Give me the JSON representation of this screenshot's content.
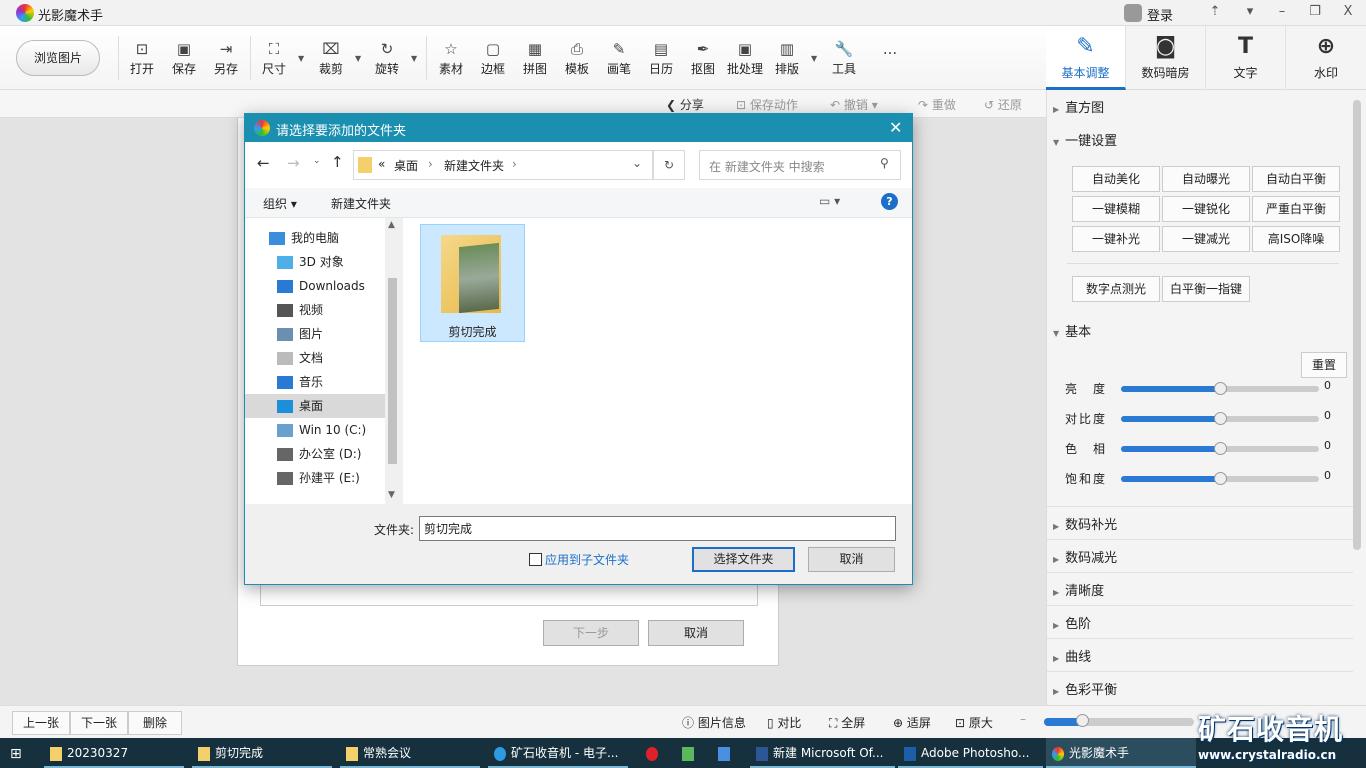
{
  "app": {
    "title": "光影魔术手",
    "login": "登录"
  },
  "toolbar": {
    "browse": "浏览图片",
    "tools": [
      "打开",
      "保存",
      "另存",
      "尺寸",
      "裁剪",
      "旋转",
      "素材",
      "边框",
      "拼图",
      "模板",
      "画笔",
      "日历",
      "抠图",
      "批处理",
      "排版",
      "工具"
    ],
    "more": "..."
  },
  "right_tabs": [
    {
      "label": "基本调整",
      "active": true
    },
    {
      "label": "数码暗房"
    },
    {
      "label": "文字"
    },
    {
      "label": "水印"
    }
  ],
  "subbar": {
    "share": "分享",
    "save_action": "保存动作",
    "undo": "撤销",
    "redo": "重做",
    "restore": "还原"
  },
  "wizard": {
    "next": "下一步",
    "cancel": "取消"
  },
  "panel": {
    "histogram": "直方图",
    "oneclick": "一键设置",
    "oneclick_buttons": [
      "自动美化",
      "自动曝光",
      "自动白平衡",
      "一键模糊",
      "一键锐化",
      "严重白平衡",
      "一键补光",
      "一键减光",
      "高ISO降噪"
    ],
    "extra_buttons": [
      "数字点测光",
      "白平衡一指键"
    ],
    "basic": "基本",
    "reset": "重置",
    "sliders": [
      {
        "label": "亮　度",
        "value": 0,
        "position": 0.5
      },
      {
        "label": "对比度",
        "value": 0,
        "position": 0.5
      },
      {
        "label": "色　相",
        "value": 0,
        "position": 0.5
      },
      {
        "label": "饱和度",
        "value": 0,
        "position": 0.5
      }
    ],
    "sections": [
      "数码补光",
      "数码减光",
      "清晰度",
      "色阶",
      "曲线",
      "色彩平衡"
    ]
  },
  "bottom": {
    "prev": "上一张",
    "next": "下一张",
    "delete": "删除",
    "info": "图片信息",
    "compare": "对比",
    "fullscreen": "全屏",
    "fit": "适屏",
    "original": "原大",
    "zoom": 0.25
  },
  "dialog": {
    "title": "请选择要添加的文件夹",
    "breadcrumb": [
      "«",
      "桌面",
      "新建文件夹"
    ],
    "search_placeholder": "在 新建文件夹 中搜索",
    "organize": "组织",
    "new_folder": "新建文件夹",
    "tree": [
      "我的电脑",
      "3D 对象",
      "Downloads",
      "视频",
      "图片",
      "文档",
      "音乐",
      "桌面",
      "Win 10 (C:)",
      "办公室 (D:)",
      "孙建平 (E:)"
    ],
    "file": "剪切完成",
    "folder_label": "文件夹:",
    "folder_value": "剪切完成",
    "apply_sub": "应用到子文件夹",
    "select": "选择文件夹",
    "cancel": "取消"
  },
  "taskbar": [
    "20230327",
    "剪切完成",
    "常熟会议",
    "矿石收音机 - 电子...",
    "新建 Microsoft Of...",
    "Adobe Photosho...",
    "光影魔术手"
  ],
  "watermark": {
    "line1": "矿石收音机",
    "line2": "www.crystalradio.cn"
  }
}
